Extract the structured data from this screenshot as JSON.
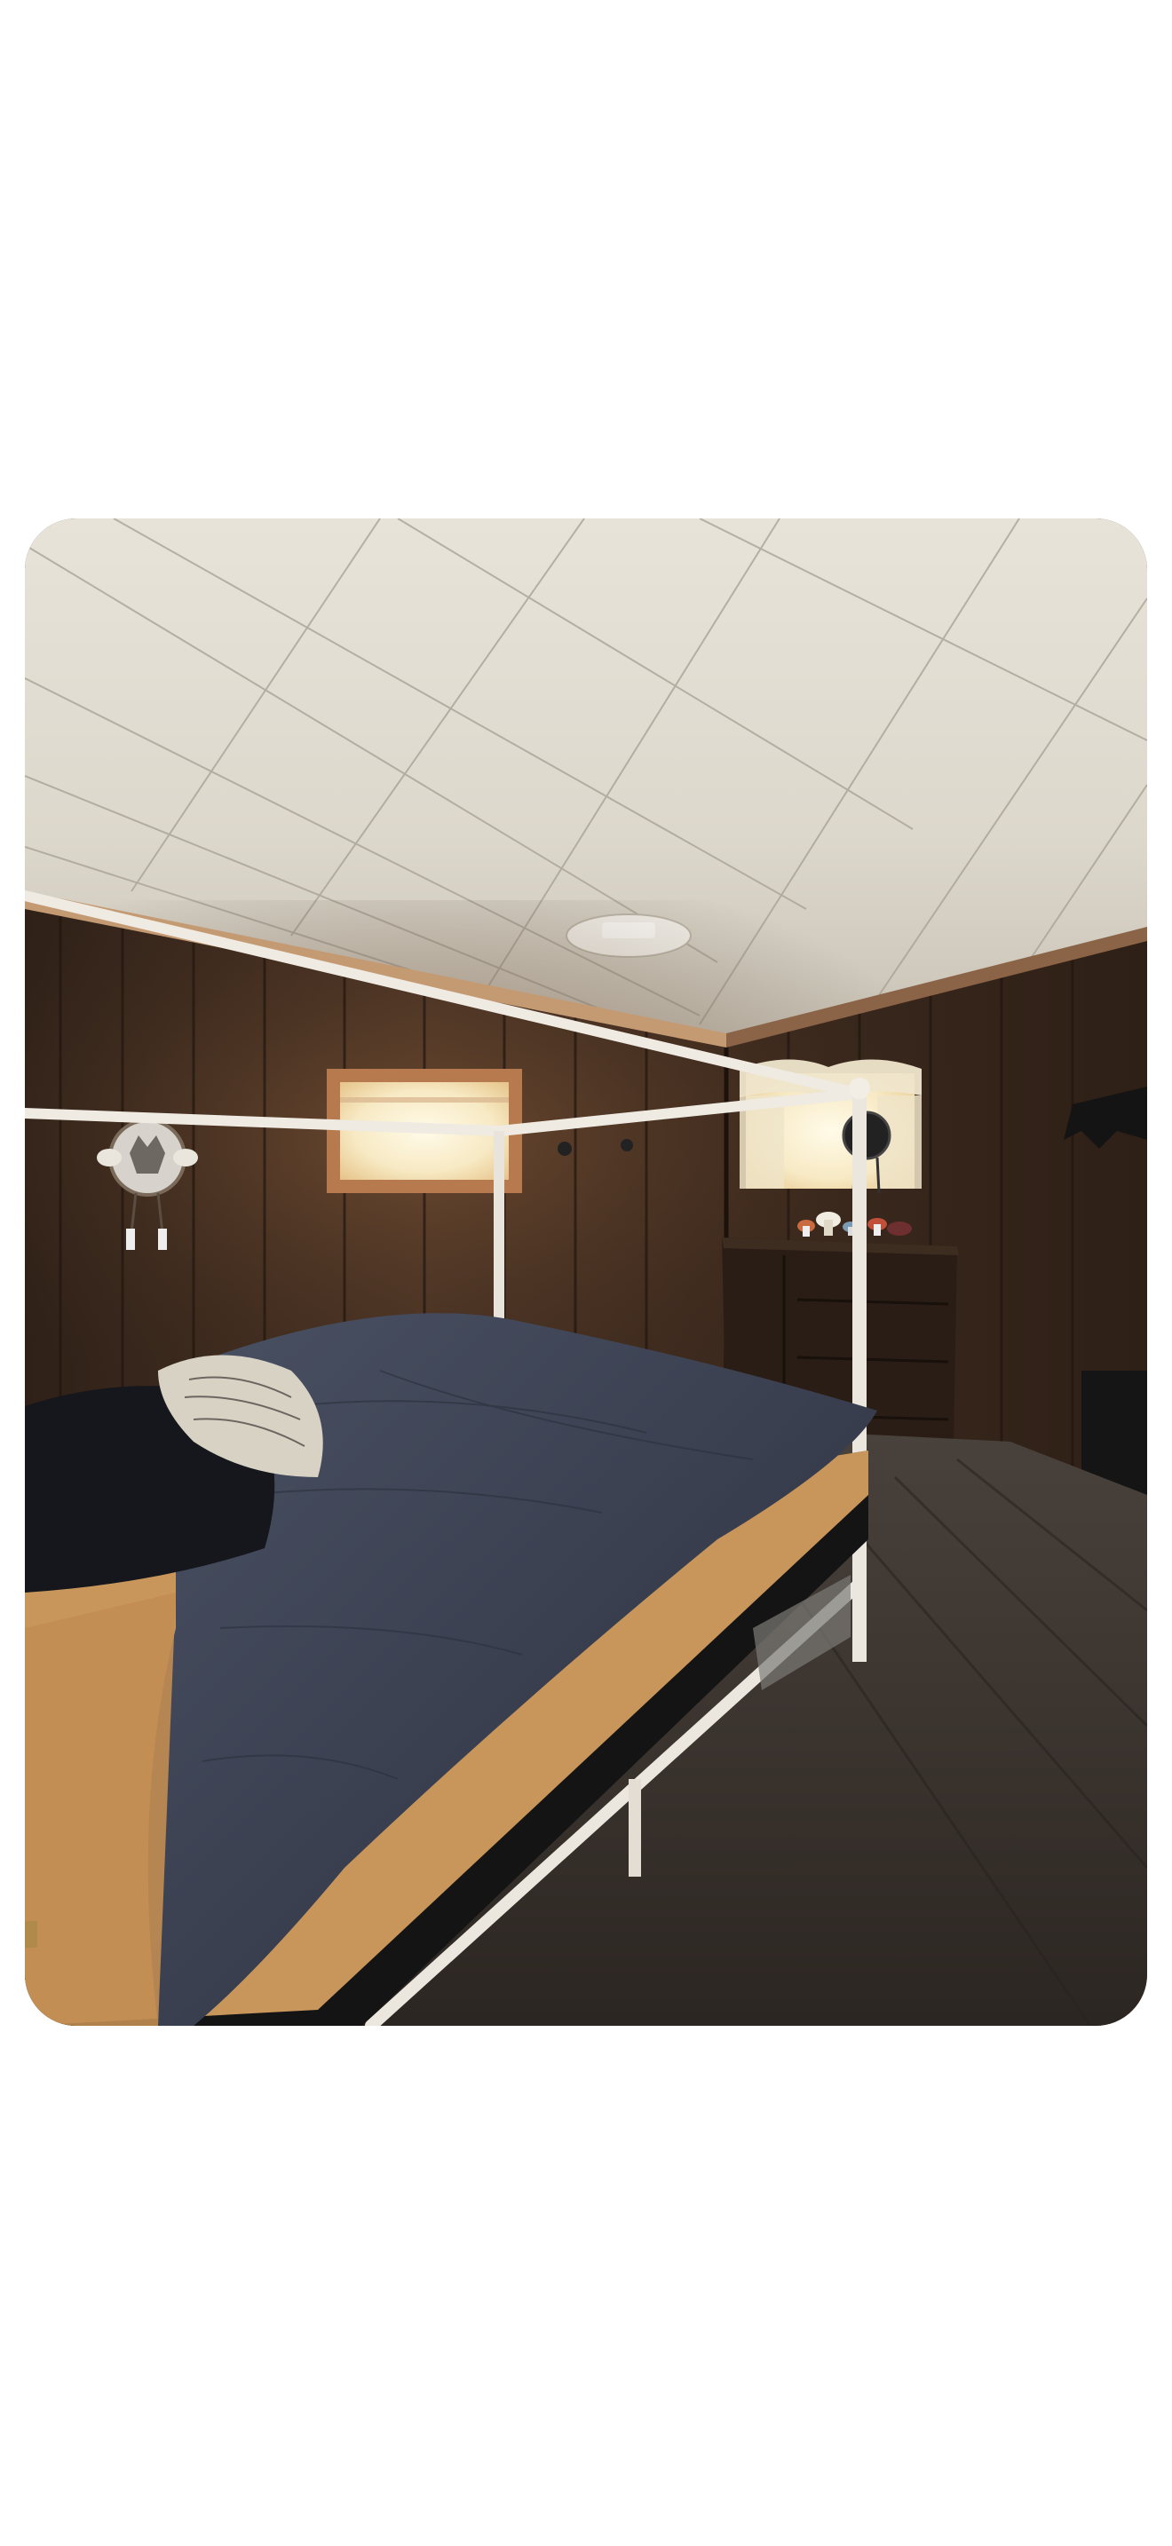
{
  "screen": {
    "background": "#ffffff"
  },
  "photo": {
    "subject": "bedroom-with-canopy-bed",
    "palette": {
      "ceiling": "#e4e0d6",
      "ceiling_grid": "#a9a396",
      "wall_paneling": "#3b291d",
      "floor": "#3a3430",
      "bed_frame": "#efeae2",
      "comforter": "#3b4150",
      "mattress": "#c8955a",
      "window_glow": "#fff6dc"
    }
  }
}
